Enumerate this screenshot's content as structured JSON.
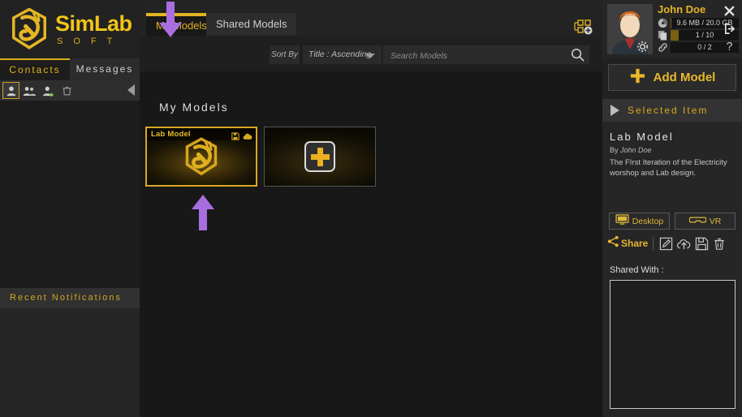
{
  "brand": {
    "name": "SimLab",
    "sub": "S O F T",
    "logo_icon": "simlab-dragon-logo"
  },
  "sidebar": {
    "tabs": [
      {
        "label": "Contacts",
        "active": true
      },
      {
        "label": "Messages",
        "active": false
      }
    ],
    "toolbar_icons": [
      {
        "name": "contact-icon",
        "selected": true
      },
      {
        "name": "contact-group-icon",
        "selected": false
      },
      {
        "name": "add-contact-icon",
        "selected": false
      },
      {
        "name": "delete-contact-icon",
        "selected": false
      }
    ],
    "collapse_icon": "collapse-left-icon",
    "notifications_title": "Recent Notifications"
  },
  "main": {
    "tabs": [
      {
        "label": "My Models",
        "active": true
      },
      {
        "label": "Shared Models",
        "active": false
      }
    ],
    "group_icon": "add-group-icon",
    "sort": {
      "label": "Sort By",
      "value": "Title : Ascending",
      "caret_icon": "chevron-down-icon"
    },
    "search": {
      "value": "",
      "placeholder": "Search Models",
      "icon": "search-icon"
    },
    "section_title": "My Models",
    "cards": [
      {
        "title": "Lab Model",
        "selected": true,
        "icons": [
          "save-icon",
          "cloud-icon"
        ]
      },
      {
        "title": "",
        "selected": false,
        "add_new": true,
        "icons": [
          "plus-icon"
        ]
      }
    ]
  },
  "user": {
    "name": "John Doe",
    "avatar_icon": "user-avatar",
    "settings_icon": "gear-icon",
    "stats": [
      {
        "icon": "storage-icon",
        "text": "9.6 MB / 20.0 GB",
        "fill_percent": 0
      },
      {
        "icon": "models-icon",
        "text": "1 / 10",
        "fill_percent": 10
      },
      {
        "icon": "links-icon",
        "text": "0 / 2",
        "fill_percent": 0
      }
    ],
    "window_buttons": [
      {
        "name": "close-icon",
        "glyph": "✕"
      },
      {
        "name": "logout-icon",
        "glyph": "logout"
      },
      {
        "name": "help-icon",
        "glyph": "?"
      }
    ]
  },
  "details": {
    "add_model_label": "Add Model",
    "add_model_icon": "plus-icon",
    "selected_item_label": "Selected Item",
    "expander_icon": "triangle-right-icon",
    "model_title": "Lab Model",
    "by_prefix": "By",
    "by_author": "John Doe",
    "description": "The FIrst Iteration of the Electricity worshop and Lab design.",
    "view_buttons": [
      {
        "label": "Desktop",
        "icon": "monitor-icon"
      },
      {
        "label": "VR",
        "icon": "vr-headset-icon"
      }
    ],
    "share_label": "Share",
    "share_icon": "share-icon",
    "action_icons": [
      {
        "name": "edit-icon"
      },
      {
        "name": "upload-cloud-icon"
      },
      {
        "name": "save-icon"
      },
      {
        "name": "delete-icon"
      }
    ],
    "shared_with_label": "Shared With :",
    "shared_with_items": []
  },
  "annotations": {
    "color": "#a86ee0",
    "arrows": [
      {
        "name": "arrow-down-my-models",
        "direction": "down"
      },
      {
        "name": "arrow-up-lab-model-card",
        "direction": "up"
      }
    ]
  }
}
